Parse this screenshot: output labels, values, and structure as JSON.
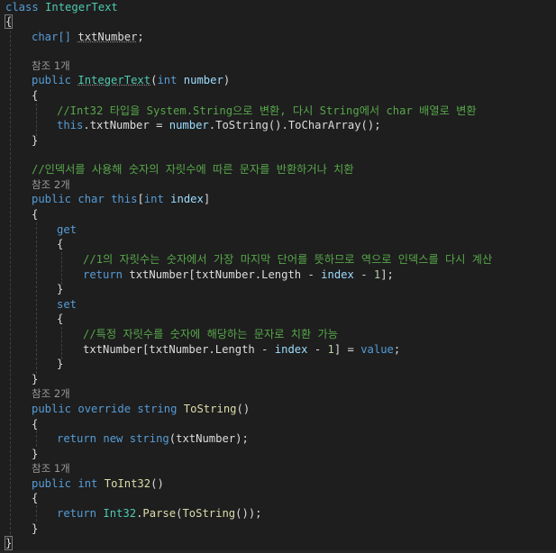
{
  "code": {
    "class_header": {
      "kw": "class",
      "name": "IntegerText"
    },
    "open_brace": "{",
    "field": {
      "type": "char[]",
      "name": "txtNumber",
      "end": ";"
    },
    "ref1": "참조 1개",
    "ctor": {
      "kw": "public",
      "name": "IntegerText",
      "paren_open": "(",
      "ptype": "int",
      "pname": "number",
      "paren_close": ")"
    },
    "ctor_open": "{",
    "ctor_comment": "//Int32 타입을 System.String으로 변환, 다시 String에서 char 배열로 변환",
    "ctor_stmt": {
      "this": "this",
      "lhs": ".txtNumber = ",
      "rhs": "number",
      "call": ".ToString().ToCharArray();"
    },
    "ctor_close": "}",
    "indexer_comment": "//인덱서를 사용해 숫자의 자릿수에 따른 문자를 반환하거나 치환",
    "ref2": "참조 2개",
    "indexer": {
      "kw1": "public",
      "kw2": "char",
      "kw3": "this",
      "bopen": "[",
      "ptype": "int",
      "pname": "index",
      "bclose": "]"
    },
    "indexer_open": "{",
    "get_kw": "get",
    "get_open": "{",
    "get_comment": "//1의 자릿수는 숫자에서 가장 마지막 단어를 뜻하므로 역으로 인덱스를 다시 계산",
    "get_return": {
      "kw": "return",
      "a": "txtNumber[txtNumber.Length - ",
      "idx": "index",
      "b": " - ",
      "one": "1",
      "c": "];"
    },
    "get_close": "}",
    "set_kw": "set",
    "set_open": "{",
    "set_comment": "//특정 자릿수를 숫자에 해당하는 문자로 치환 가능",
    "set_stmt": {
      "a": "txtNumber[txtNumber.Length - ",
      "idx": "index",
      "b": " - ",
      "one": "1",
      "c": "] = ",
      "val": "value",
      "d": ";"
    },
    "set_close": "}",
    "indexer_close": "}",
    "ref3": "참조 2개",
    "tostring": {
      "kw1": "public",
      "kw2": "override",
      "kw3": "string",
      "name": "ToString",
      "parens": "()"
    },
    "tostring_open": "{",
    "tostring_return": {
      "kw": "return",
      "new": "new",
      "type": "string",
      "args": "(txtNumber);"
    },
    "tostring_close": "}",
    "ref4": "참조 1개",
    "toint": {
      "kw1": "public",
      "kw2": "int",
      "name": "ToInt32",
      "parens": "()"
    },
    "toint_open": "{",
    "toint_return": {
      "kw": "return",
      "type": "Int32",
      "dot": ".",
      "m1": "Parse",
      "p1": "(",
      "m2": "ToString",
      "rest": "());"
    },
    "toint_close": "}",
    "class_close": "}"
  }
}
